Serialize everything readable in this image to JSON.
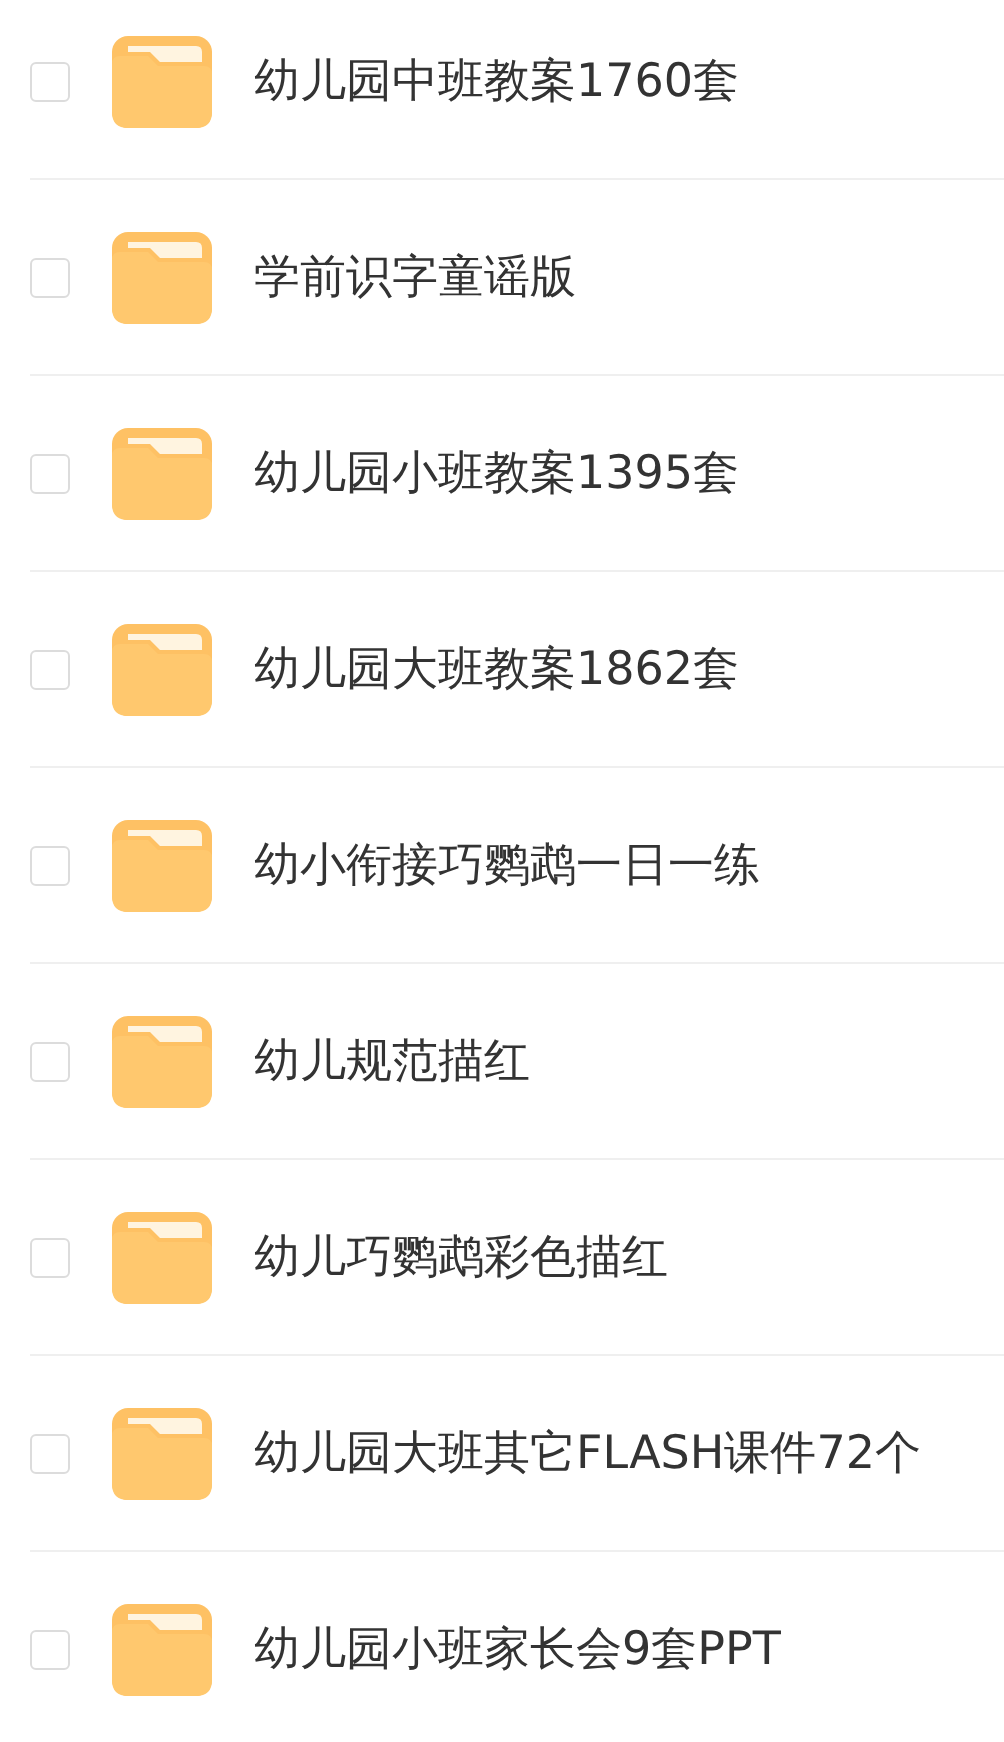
{
  "files": [
    {
      "name": "幼儿园中班教案1760套",
      "checked": false
    },
    {
      "name": "学前识字童谣版",
      "checked": false
    },
    {
      "name": "幼儿园小班教案1395套",
      "checked": false
    },
    {
      "name": "幼儿园大班教案1862套",
      "checked": false
    },
    {
      "name": "幼小衔接巧鹦鹉一日一练",
      "checked": false
    },
    {
      "name": "幼儿规范描红",
      "checked": false
    },
    {
      "name": "幼儿巧鹦鹉彩色描红",
      "checked": false
    },
    {
      "name": "幼儿园大班其它FLASH课件72个",
      "checked": false
    },
    {
      "name": "幼儿园小班家长会9套PPT",
      "checked": false
    }
  ]
}
